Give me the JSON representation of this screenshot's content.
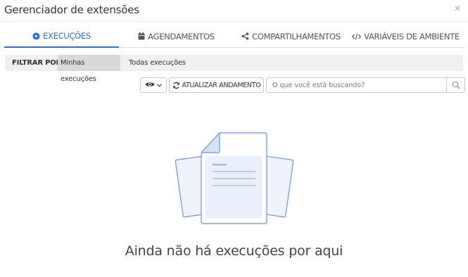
{
  "window": {
    "title": "Gerenciador de extensões",
    "close_icon": "×"
  },
  "tabs": [
    {
      "label": "EXECUÇÕES",
      "icon": "play-circle-icon",
      "active": true
    },
    {
      "label": "AGENDAMENTOS",
      "icon": "calendar-icon",
      "active": false
    },
    {
      "label": "COMPARTILHAMENTOS",
      "icon": "share-icon",
      "active": false
    },
    {
      "label": "VARIÁVEIS DE AMBIENTE",
      "icon": "code-icon",
      "active": false
    }
  ],
  "filter": {
    "label": "FILTRAR POR",
    "options": [
      {
        "label": "Minhas execuções",
        "selected": true
      },
      {
        "label": "Todas execuções",
        "selected": false
      }
    ]
  },
  "toolbar": {
    "view_icon": "eye-icon",
    "refresh_label": "ATUALIZAR ANDAMENTO",
    "search_placeholder": "O que você está buscando?",
    "search_icon": "search-icon"
  },
  "empty_state": {
    "message": "Ainda não há execuções por aqui",
    "illustration": "documents-illustration"
  },
  "colors": {
    "accent": "#2a6fd6",
    "illustration_stroke": "#7fa2d8",
    "illustration_fill": "#e9f0fb",
    "filter_bg": "#f0f0f0",
    "filter_selected_bg": "#d9d9d9"
  }
}
